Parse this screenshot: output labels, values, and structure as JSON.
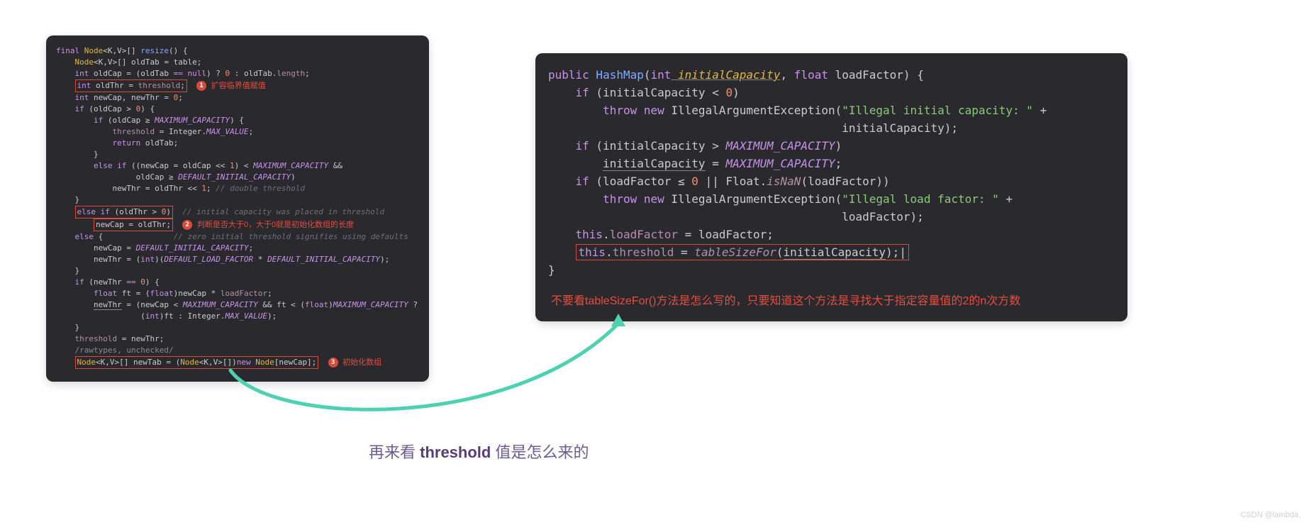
{
  "left_code": {
    "line1_a": "final",
    "line1_b": "Node",
    "line1_c": "<K,V>[] ",
    "line1_d": "resize",
    "line1_e": "() {",
    "line2_a": "Node",
    "line2_b": "<K,V>[] oldTab = table;",
    "line3_a": "int",
    "line3_b": " oldCap = (oldTab ",
    "line3_c": "==",
    "line3_d": " null",
    "line3_e": ") ? ",
    "line3_f": "0",
    "line3_g": " : oldTab.",
    "line3_h": "length",
    "line3_i": ";",
    "line4_a": "int",
    "line4_b": " oldThr = ",
    "line4_c": "threshold",
    "line4_d": ";",
    "badge1": "1",
    "anno1": "扩容临界值赋值",
    "line5_a": "int",
    "line5_b": " newCap, newThr = ",
    "line5_c": "0",
    "line5_d": ";",
    "line6_a": "if",
    "line6_b": " (oldCap > ",
    "line6_c": "0",
    "line6_d": ") {",
    "line7_a": "if",
    "line7_b": " (oldCap ",
    "line7_c": "≥",
    "line7_d": " MAXIMUM_CAPACITY",
    "line7_e": ") {",
    "line8_a": "threshold",
    "line8_b": " = Integer.",
    "line8_c": "MAX_VALUE",
    "line8_d": ";",
    "line9_a": "return",
    "line9_b": " oldTab;",
    "line10": "}",
    "line11_a": "else if",
    "line11_b": " ((newCap = oldCap << ",
    "line11_c": "1",
    "line11_d": ") < ",
    "line11_e": "MAXIMUM_CAPACITY",
    "line11_f": " &&",
    "line12_a": "oldCap ",
    "line12_b": "≥",
    "line12_c": " DEFAULT_INITIAL_CAPACITY",
    "line12_d": ")",
    "line13_a": "newThr = oldThr << ",
    "line13_b": "1",
    "line13_c": "; ",
    "line13_d": "// double threshold",
    "line14": "}",
    "line15_a": "else if",
    "line15_b": " (oldThr > ",
    "line15_c": "0",
    "line15_d": ")",
    "line15_e": "// initial capacity was placed in threshold",
    "line16_a": "newCap = oldThr;",
    "badge2": "2",
    "anno2": "判断是否大于0，大于0就是初始化数组的长度",
    "line17_a": "else",
    "line17_b": " {",
    "line17_c": "// zero initial threshold signifies using defaults",
    "line18_a": "newCap = ",
    "line18_b": "DEFAULT_INITIAL_CAPACITY",
    "line18_c": ";",
    "line19_a": "newThr = (",
    "line19_b": "int",
    "line19_c": ")(",
    "line19_d": "DEFAULT_LOAD_FACTOR",
    "line19_e": " * ",
    "line19_f": "DEFAULT_INITIAL_CAPACITY",
    "line19_g": ");",
    "line20": "}",
    "line21_a": "if",
    "line21_b": " (newThr ",
    "line21_c": "==",
    "line21_d": " 0",
    "line21_e": ") {",
    "line22_a": "float",
    "line22_b": " ft = (",
    "line22_c": "float",
    "line22_d": ")newCap * ",
    "line22_e": "loadFactor",
    "line22_f": ";",
    "line23_a": "newThr",
    "line23_b": " = (newCap < ",
    "line23_c": "MAXIMUM_CAPACITY",
    "line23_d": " && ft < (",
    "line23_e": "float",
    "line23_f": ")",
    "line23_g": "MAXIMUM_CAPACITY",
    "line23_h": " ?",
    "line24_a": "(",
    "line24_b": "int",
    "line24_c": ")ft : Integer.",
    "line24_d": "MAX_VALUE",
    "line24_e": ");",
    "line25": "}",
    "line26_a": "threshold",
    "line26_b": " = newThr;",
    "line27": "/rawtypes, unchecked/",
    "line28_a": "Node",
    "line28_b": "<K,V>[] newTab = (",
    "line28_c": "Node",
    "line28_d": "<K,V>[])",
    "line28_e": "new",
    "line28_f": " Node",
    "line28_g": "[newCap];",
    "badge3": "3",
    "anno3": "初始化数组"
  },
  "right_code": {
    "l1_a": "public",
    "l1_b": " HashMap",
    "l1_c": "(",
    "l1_d": "int",
    "l1_e": " initialCapacity",
    "l1_f": ", ",
    "l1_g": "float",
    "l1_h": " loadFactor) {",
    "l2_a": "if",
    "l2_b": " (initialCapacity < ",
    "l2_c": "0",
    "l2_d": ")",
    "l3_a": "throw new",
    "l3_b": " IllegalArgumentException(",
    "l3_c": "\"Illegal initial capacity: \"",
    "l3_d": " +",
    "l4_a": "initialCapacity);",
    "l5_a": "if",
    "l5_b": " (initialCapacity > ",
    "l5_c": "MAXIMUM_CAPACITY",
    "l5_d": ")",
    "l6_a": "initialCapacity",
    "l6_b": " = ",
    "l6_c": "MAXIMUM_CAPACITY",
    "l6_d": ";",
    "l7_a": "if",
    "l7_b": " (loadFactor ",
    "l7_c": "≤",
    "l7_d": " 0",
    "l7_e": " || Float.",
    "l7_f": "isNaN",
    "l7_g": "(loadFactor))",
    "l8_a": "throw new",
    "l8_b": " IllegalArgumentException(",
    "l8_c": "\"Illegal load factor: \"",
    "l8_d": " +",
    "l9_a": "loadFactor);",
    "l10_a": "this",
    "l10_b": ".",
    "l10_c": "loadFactor",
    "l10_d": " = loadFactor;",
    "l11_a": "this",
    "l11_b": ".",
    "l11_c": "threshold",
    "l11_d": " = ",
    "l11_e": "tableSizeFor",
    "l11_f": "(",
    "l11_g": "initialCapacity",
    "l11_h": ");",
    "l11_i": "|",
    "l12": "}",
    "anno": "不要看tableSizeFor()方法是怎么写的，只要知道这个方法是寻找大于指定容量值的2的n次方数"
  },
  "caption_a": "再来看 ",
  "caption_b": "threshold",
  "caption_c": " 值是怎么来的",
  "watermark": "CSDN @lambda."
}
